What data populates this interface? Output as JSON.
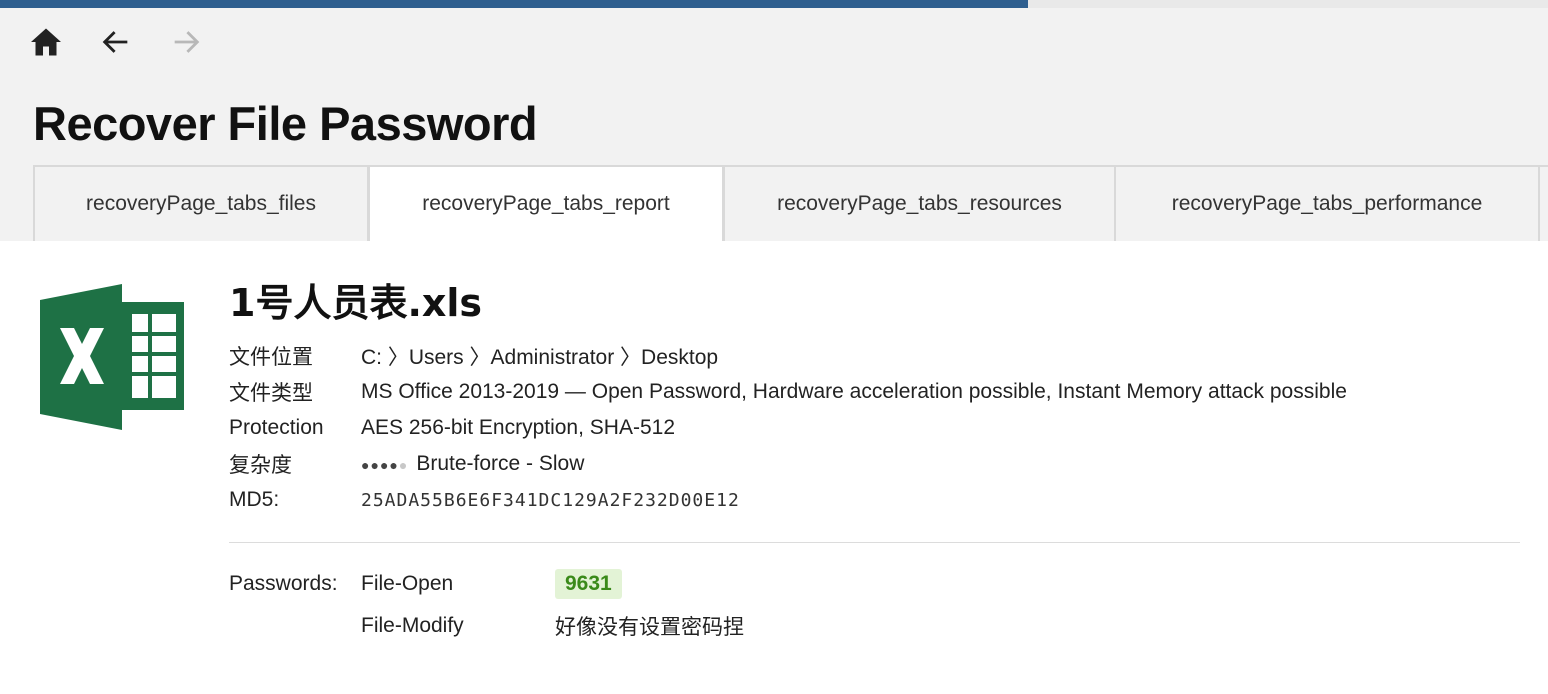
{
  "page": {
    "title": "Recover File Password"
  },
  "nav": {
    "home_icon": "home-icon",
    "back_icon": "arrow-left-icon",
    "forward_icon": "arrow-right-icon"
  },
  "tabs": [
    {
      "label": "recoveryPage_tabs_files",
      "active": false
    },
    {
      "label": "recoveryPage_tabs_report",
      "active": true
    },
    {
      "label": "recoveryPage_tabs_resources",
      "active": false
    },
    {
      "label": "recoveryPage_tabs_performance",
      "active": false
    }
  ],
  "file": {
    "icon": "excel-file-icon",
    "name": "1号人员表.xls",
    "fields": {
      "location_label": "文件位置",
      "location_value": "C: 〉Users 〉Administrator 〉Desktop",
      "type_label": "文件类型",
      "type_value": "MS Office 2013-2019 — Open Password, Hardware acceleration possible, Instant Memory attack possible",
      "protection_label": "Protection",
      "protection_value": "AES 256-bit Encryption, SHA-512",
      "complexity_label": "复杂度",
      "complexity_level": 4,
      "complexity_max": 5,
      "complexity_value": "Brute-force - Slow",
      "md5_label": "MD5:",
      "md5_value": "25ADA55B6E6F341DC129A2F232D00E12"
    }
  },
  "passwords": {
    "label": "Passwords:",
    "open_type": "File-Open",
    "open_value": "9631",
    "modify_type": "File-Modify",
    "modify_value": "好像没有设置密码捏"
  },
  "colors": {
    "excel_green": "#1e7145",
    "badge_bg": "#e3f3d6",
    "badge_fg": "#3a8a1a",
    "header_bg": "#f2f2f2"
  }
}
